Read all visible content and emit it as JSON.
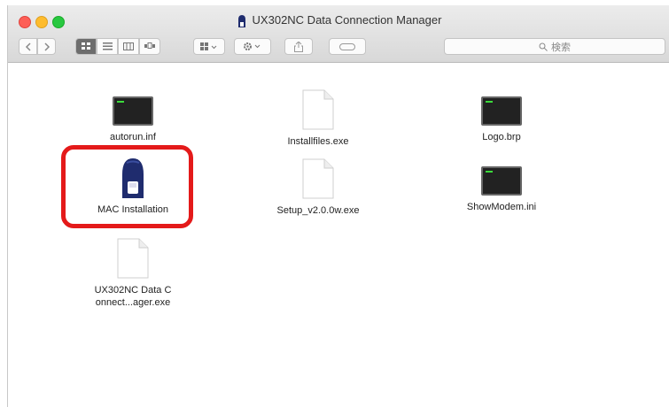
{
  "window": {
    "title": "UX302NC Data Connection Manager"
  },
  "toolbar": {
    "search_label": "検索",
    "icons": [
      "back-icon",
      "forward-icon",
      "icon-view-icon",
      "list-view-icon",
      "column-view-icon",
      "cover-flow-icon",
      "arrange-icon",
      "action-gear-icon",
      "share-icon",
      "tag-icon",
      "search-icon"
    ]
  },
  "files": [
    {
      "name": "autorun.inf",
      "icon": "terminal-icon"
    },
    {
      "name": "Installfiles.exe",
      "icon": "document-icon"
    },
    {
      "name": "Logo.brp",
      "icon": "terminal-icon"
    },
    {
      "name": "MAC Installation",
      "icon": "usb-modem-icon"
    },
    {
      "name": "Setup_v2.0.0w.exe",
      "icon": "document-icon"
    },
    {
      "name": "ShowModem.ini",
      "icon": "terminal-icon"
    },
    {
      "name": "UX302NC Data Connect...ager.exe",
      "icon": "document-icon"
    }
  ],
  "colors": {
    "highlight": "#e41a1a",
    "selected_view": "#6d6d6d"
  }
}
